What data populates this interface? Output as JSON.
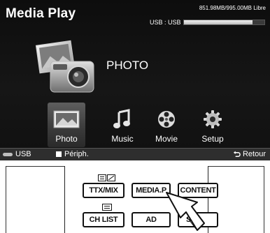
{
  "screen": {
    "title": "Media Play",
    "storage_text": "851.98MB/995.00MB Libre",
    "device_label": "USB : USB",
    "storage_used_fraction": 0.856,
    "category": "PHOTO",
    "menu": [
      {
        "label": "Photo",
        "icon": "photo-icon",
        "selected": true
      },
      {
        "label": "Music",
        "icon": "music-note-icon",
        "selected": false
      },
      {
        "label": "Movie",
        "icon": "film-reel-icon",
        "selected": false
      },
      {
        "label": "Setup",
        "icon": "gear-icon",
        "selected": false
      }
    ],
    "bottom": {
      "usb": "USB",
      "device": "Périph.",
      "back": "Retour"
    }
  },
  "remote": {
    "buttons": {
      "ttx": "TTX/MIX",
      "media": "MEDIA.P",
      "content": "CONTENT",
      "chlist": "CH LIST",
      "ad": "AD",
      "s_partial": "S"
    }
  },
  "colors": {
    "screen_bg": "#111111",
    "text": "#ffffff",
    "highlight": "#4a4a4a"
  }
}
